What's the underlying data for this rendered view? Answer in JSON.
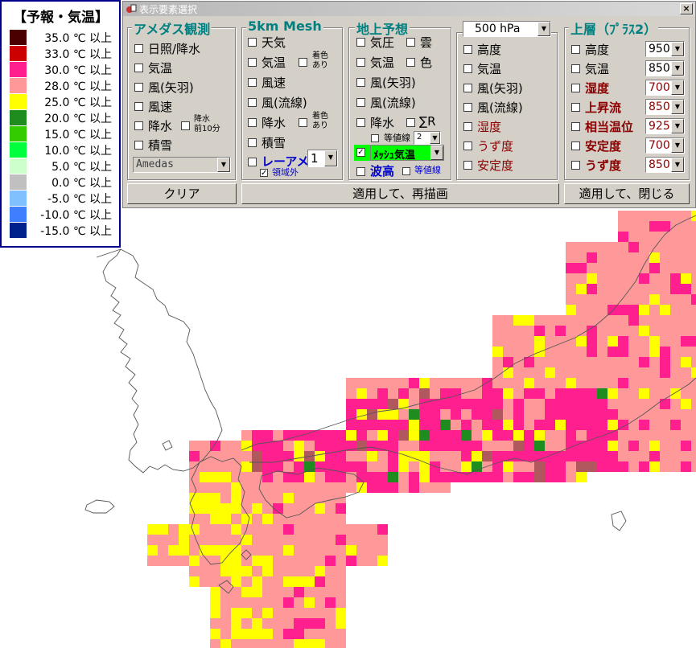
{
  "legend": {
    "title": "【予報・気温】",
    "rows": [
      {
        "label": "35.0 ℃ 以上",
        "color": "#4a0000"
      },
      {
        "label": "33.0 ℃ 以上",
        "color": "#cc0000"
      },
      {
        "label": "30.0 ℃ 以上",
        "color": "#ff1f8f"
      },
      {
        "label": "28.0 ℃ 以上",
        "color": "#ff9999"
      },
      {
        "label": "25.0 ℃ 以上",
        "color": "#ffff00"
      },
      {
        "label": "20.0 ℃ 以上",
        "color": "#1e8c1e"
      },
      {
        "label": "15.0 ℃ 以上",
        "color": "#33cc00"
      },
      {
        "label": "10.0 ℃ 以上",
        "color": "#00ff3c"
      },
      {
        "label": "5.0 ℃ 以上",
        "color": "#ccffcc"
      },
      {
        "label": "0.0 ℃ 以上",
        "color": "#c0c0c0"
      },
      {
        "label": "-5.0 ℃ 以上",
        "color": "#80c0ff"
      },
      {
        "label": "-10.0 ℃ 以上",
        "color": "#3f7fff"
      },
      {
        "label": "-15.0 ℃ 以上",
        "color": "#00208c"
      }
    ]
  },
  "dialog": {
    "title": "表示要素選択",
    "close": "×",
    "amedas": {
      "title": "アメダス観測",
      "items": {
        "sunshine": "日照/降水",
        "temp": "気温",
        "wind_arrow": "風(矢羽)",
        "wind_speed": "風速",
        "precip": "降水",
        "precip10a": "降水",
        "precip10b": "前10分",
        "snow": "積雪"
      },
      "source": "Amedas"
    },
    "mesh": {
      "title": "5km Mesh",
      "items": {
        "weather": "天気",
        "temp": "気温",
        "color_a": "着色",
        "color_b": "あり",
        "wind_speed": "風速",
        "wind_stream": "風(流線)",
        "precip": "降水",
        "color2_a": "着色",
        "color2_b": "あり",
        "snow": "積雪",
        "radar": "レーアメ",
        "radar_level": "1",
        "outside": "領域外"
      }
    },
    "surface": {
      "title": "地上予想",
      "items": {
        "pressure": "気圧",
        "cloud": "雲",
        "temp": "気温",
        "color": "色",
        "wind_arrow": "風(矢羽)",
        "wind_stream": "風(流線)",
        "precip": "降水",
        "sum_r": "∑R",
        "contour": "等値線",
        "contour_level": "2",
        "mesh_temp": "ﾒｯｼｭ気温",
        "wave": "波高",
        "wave_contour": "等値線"
      }
    },
    "hpa": {
      "level": "500 hPa",
      "items": {
        "height": "高度",
        "temp": "気温",
        "wind_arrow": "風(矢羽)",
        "wind_stream": "風(流線)",
        "humidity": "湿度",
        "vorticity": "うず度",
        "stability": "安定度"
      }
    },
    "upper": {
      "title": "上層（ﾌﾟﾗｽ2）",
      "items": {
        "height": "高度",
        "temp": "気温",
        "humidity": "湿度",
        "updraft": "上昇流",
        "theta": "相当温位",
        "stability": "安定度",
        "vorticity": "うず度"
      },
      "levels": {
        "height": "950",
        "temp": "850",
        "humidity": "700",
        "updraft": "850",
        "theta": "925",
        "stability": "700",
        "vorticity": "850"
      }
    },
    "buttons": {
      "clear": "クリア",
      "apply_redraw": "適用して、再描画",
      "apply_close": "適用して、閉じる"
    }
  }
}
